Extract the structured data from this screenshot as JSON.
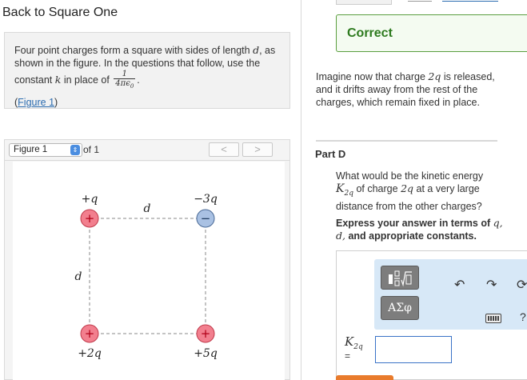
{
  "left": {
    "title": "Back to Square One",
    "intro": {
      "text_1": "Four point charges form a square with sides of length",
      "var_d": "d",
      "text_2": ", as shown in the figure. In the questions that follow, use the constant",
      "var_k": "k",
      "text_3": "in place of",
      "frac_num": "1",
      "frac_den": "4πϵ",
      "frac_den_sub": "0",
      "text_4": ".",
      "figure_link": "Figure 1"
    },
    "figure_panel": {
      "select_value": "Figure 1",
      "of_text": "of 1",
      "prev_glyph": "<",
      "next_glyph": ">"
    },
    "figure": {
      "charges": [
        {
          "label": "+q",
          "sign": "+"
        },
        {
          "label": "−3q",
          "sign": "−"
        },
        {
          "label": "+2q",
          "sign": "+"
        },
        {
          "label": "+5q",
          "sign": "+"
        }
      ],
      "side_label_top": "d",
      "side_label_left": "d",
      "colors": {
        "positive": "#f27f8e",
        "negative": "#a9c1e3",
        "dash": "#888888"
      }
    }
  },
  "right": {
    "feedback": "Correct",
    "scenario": {
      "text_1": "Imagine now that charge",
      "var": "2q",
      "text_2": "is released, and it drifts away from the rest of the charges, which remain fixed in place."
    },
    "part_label": "Part D",
    "question": {
      "text_1": "What would be the kinetic energy",
      "k_var": "K",
      "k_sub": "2q",
      "text_2": "of charge",
      "var": "2q",
      "text_3": "at a very large distance from the other charges?"
    },
    "instructions": {
      "text_1": "Express your answer in terms of",
      "vars": "q, d,",
      "text_2": "and appropriate constants."
    },
    "toolbar": {
      "template_icon": "fraction-root-template-icon",
      "symbols_label": "ΑΣφ",
      "undo_glyph": "↶",
      "redo_glyph": "↷",
      "reset_glyph": "⟳",
      "keyboard_icon": "keyboard-icon",
      "help_glyph": "?"
    },
    "answer": {
      "label": "K",
      "label_sub": "2q",
      "equals": "=",
      "value": ""
    },
    "colors": {
      "correct_green": "#2d7a1e",
      "toolbar_bg": "#d7e8f7",
      "accent_blue": "#3a73c7",
      "submit_orange": "#e97b2c"
    }
  }
}
